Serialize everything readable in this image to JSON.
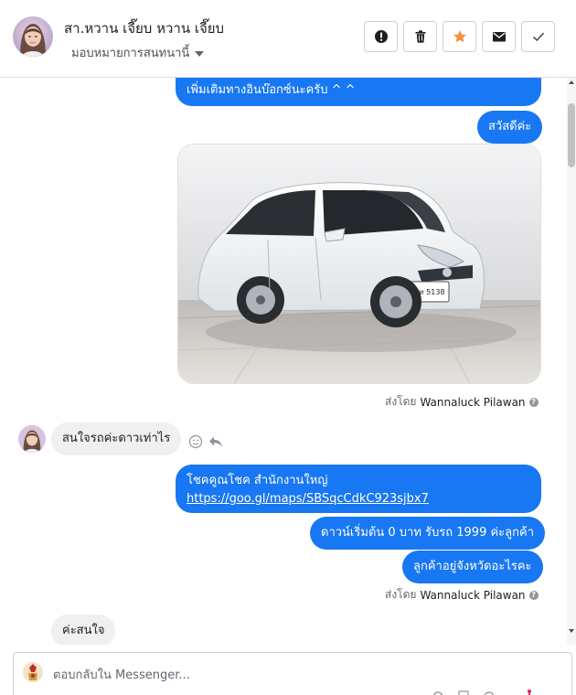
{
  "header": {
    "contact_name": "สา.หวาน เจี๊ยบ หวาน เจี๊ยบ",
    "assign_label": "มอบหมายการสนทนานี้",
    "buttons": [
      {
        "name": "mark-spam-button",
        "icon": "exclamation-circle-icon"
      },
      {
        "name": "delete-button",
        "icon": "trash-icon"
      },
      {
        "name": "star-button",
        "icon": "star-icon"
      },
      {
        "name": "mark-unread-button",
        "icon": "envelope-icon"
      },
      {
        "name": "mark-done-button",
        "icon": "checkmark-icon"
      }
    ]
  },
  "messages": {
    "top_partial_text": "เพิ่มเติมทางอินบ๊อกซ์นะครับ ^ ^",
    "greeting": "สวัสดีค่ะ",
    "photo_plate": "กท 5138",
    "sent_by_1": {
      "prefix": "ส่งโดย",
      "sender": "Wannaluck Pilawan"
    },
    "customer_msg_1": "สนใจรถค่ะดาวเท่าไร",
    "location_line": "โชคคูณโชค สำนักงานใหญ่",
    "location_link": "https://goo.gl/maps/SBSqcCdkC923sjbx7",
    "down_payment": "ดาวน์เริ่มต้น 0 บาท รับรถ 1999 ค่ะลูกค้า",
    "province_question": "ลูกค้าอยู่จังหวัดอะไรคะ",
    "sent_by_2": {
      "prefix": "ส่งโดย",
      "sender": "Wannaluck Pilawan"
    },
    "customer_msg_2": "ค่ะสนใจ"
  },
  "composer": {
    "placeholder": "ตอบกลับใน Messenger..."
  },
  "colors": {
    "outgoing_bubble": "#1877f2",
    "incoming_bubble": "#f0f0f0",
    "star": "#f7923b"
  }
}
